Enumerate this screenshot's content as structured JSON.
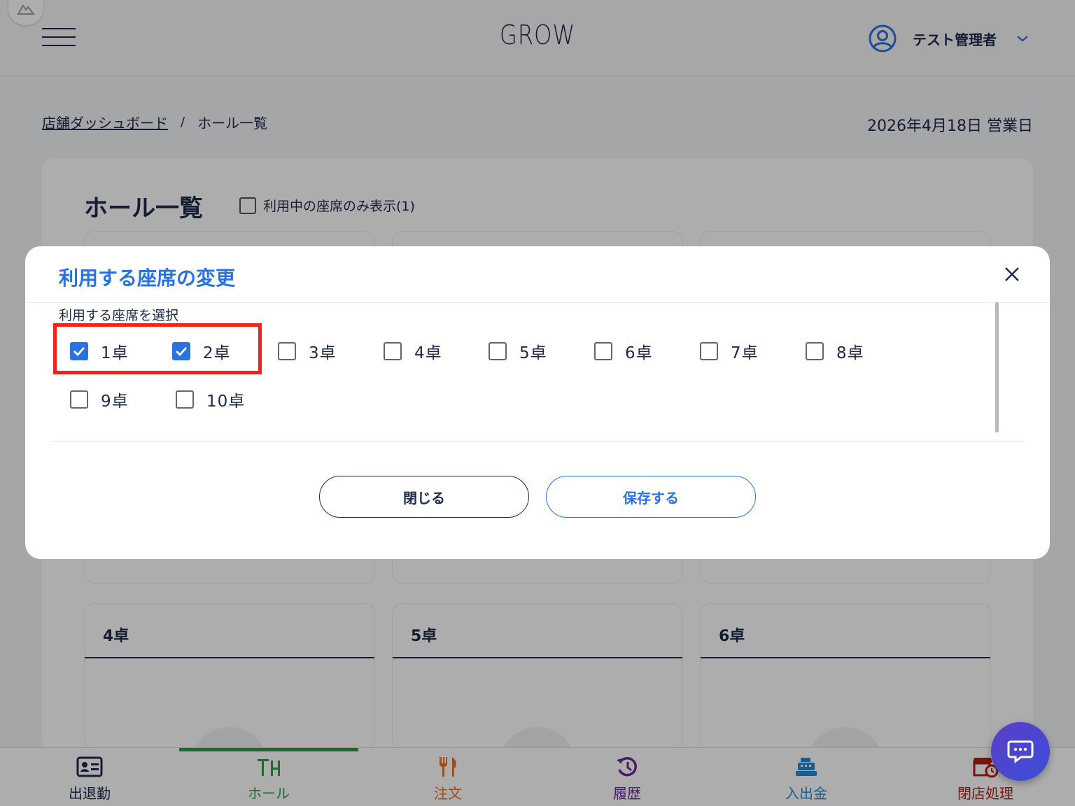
{
  "header": {
    "app_title": "GROW",
    "user_name": "テスト管理者"
  },
  "breadcrumb": {
    "parent": "店舗ダッシュボード",
    "separator": "/",
    "current": "ホール一覧"
  },
  "business_day": "2026年4月18日 営業日",
  "page": {
    "title": "ホール一覧",
    "filter_label": "利用中の座席のみ表示(1)"
  },
  "background_cards": [
    {
      "title": "4卓"
    },
    {
      "title": "5卓"
    },
    {
      "title": "6卓"
    }
  ],
  "modal": {
    "title": "利用する座席の変更",
    "select_label": "利用する座席を選択",
    "seats": [
      {
        "label": "1卓",
        "checked": true
      },
      {
        "label": "2卓",
        "checked": true
      },
      {
        "label": "3卓",
        "checked": false
      },
      {
        "label": "4卓",
        "checked": false
      },
      {
        "label": "5卓",
        "checked": false
      },
      {
        "label": "6卓",
        "checked": false
      },
      {
        "label": "7卓",
        "checked": false
      },
      {
        "label": "8卓",
        "checked": false
      },
      {
        "label": "9卓",
        "checked": false
      },
      {
        "label": "10卓",
        "checked": false
      }
    ],
    "close_button": "閉じる",
    "save_button": "保存する"
  },
  "bottom_nav": [
    {
      "label": "出退勤",
      "icon": "id-card-icon",
      "color": "#1d2a4a",
      "active": false
    },
    {
      "label": "ホール",
      "icon": "table-icon",
      "color": "#2aa043",
      "active": true
    },
    {
      "label": "注文",
      "icon": "utensils-icon",
      "color": "#e0762a",
      "active": false
    },
    {
      "label": "履歴",
      "icon": "history-icon",
      "color": "#6a2a9a",
      "active": false
    },
    {
      "label": "入出金",
      "icon": "cash-register-icon",
      "color": "#2a8ad0",
      "active": false
    },
    {
      "label": "閉店処理",
      "icon": "store-close-icon",
      "color": "#b3201a",
      "active": false
    }
  ],
  "colors": {
    "primary_navy": "#1d2a4a",
    "accent_blue": "#2a72e0",
    "highlight_red": "#f3221b",
    "active_green": "#2aa043"
  }
}
